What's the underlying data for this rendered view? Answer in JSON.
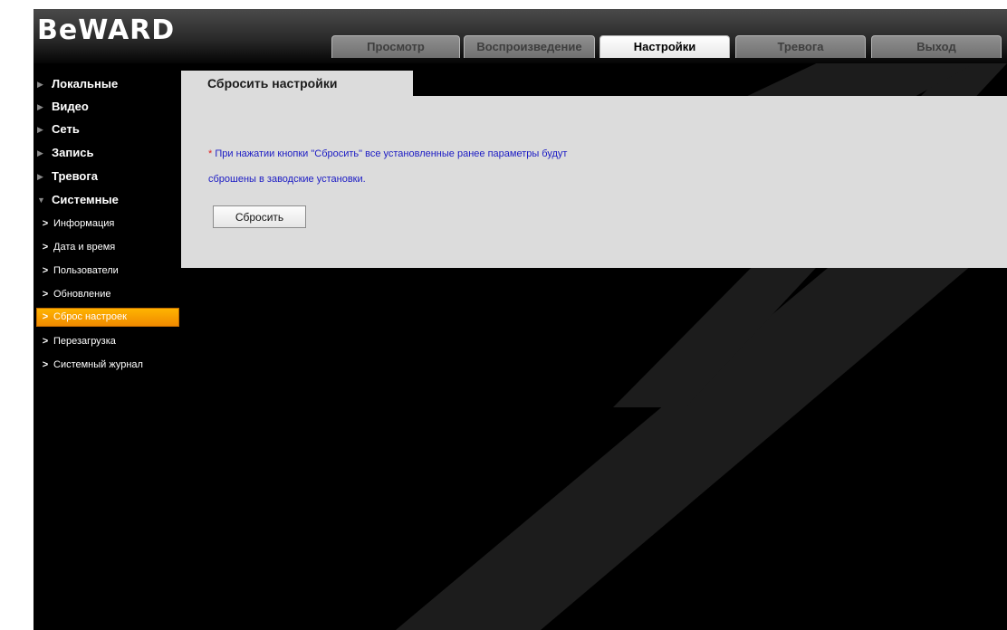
{
  "app": {
    "logo_text": "BeWARD"
  },
  "tabs": [
    {
      "label": "Просмотр",
      "active": false
    },
    {
      "label": "Воспроизведение",
      "active": false
    },
    {
      "label": "Настройки",
      "active": true
    },
    {
      "label": "Тревога",
      "active": false
    },
    {
      "label": "Выход",
      "active": false
    }
  ],
  "sidebar": {
    "sections": [
      {
        "label": "Локальные",
        "expanded": false
      },
      {
        "label": "Видео",
        "expanded": false
      },
      {
        "label": "Сеть",
        "expanded": false
      },
      {
        "label": "Запись",
        "expanded": false
      },
      {
        "label": "Тревога",
        "expanded": false
      },
      {
        "label": "Системные",
        "expanded": true
      }
    ],
    "subitems": [
      {
        "label": "Информация",
        "active": false
      },
      {
        "label": "Дата и время",
        "active": false
      },
      {
        "label": "Пользователи",
        "active": false
      },
      {
        "label": "Обновление",
        "active": false
      },
      {
        "label": "Сброс настроек",
        "active": true
      },
      {
        "label": "Перезагрузка",
        "active": false
      },
      {
        "label": "Системный журнал",
        "active": false
      }
    ]
  },
  "content": {
    "tab_title": "Сбросить настройки",
    "notice_star": "*",
    "notice_line1": "При нажатии кнопки \"Сбросить\" все установленные ранее параметры будут",
    "notice_line2": "сброшены в заводские установки.",
    "reset_button_label": "Сбросить"
  },
  "colors": {
    "background": "#000000",
    "accent": "#f5a000",
    "panel": "#dcdcdc",
    "notice_text": "#1b1bc4",
    "notice_star": "#e02020"
  },
  "icons": {
    "section_marker": "triangle-right-icon",
    "expanded_marker": "triangle-down-icon",
    "subitem_marker": "chevron-right-icon"
  }
}
